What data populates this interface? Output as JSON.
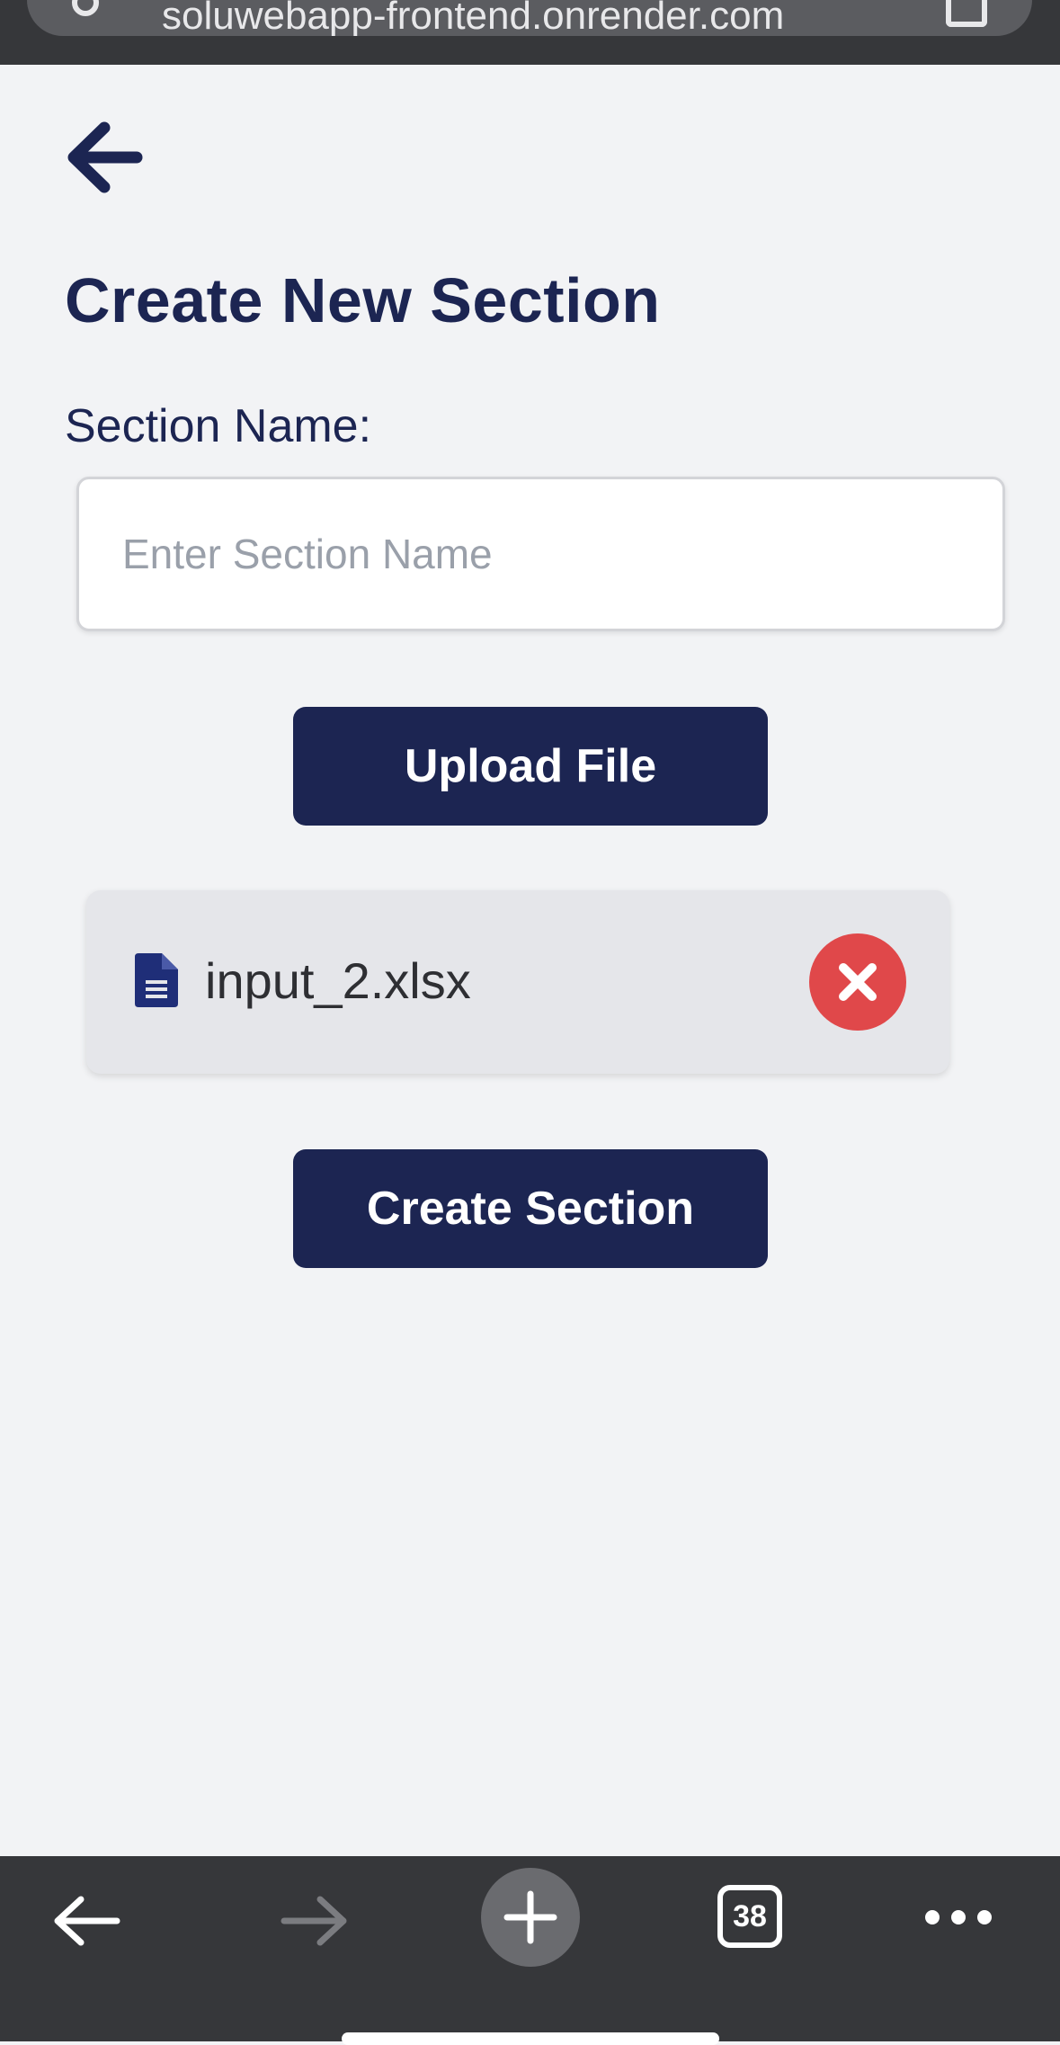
{
  "browser": {
    "url": "soluwebapp-frontend.onrender.com"
  },
  "page": {
    "title": "Create New Section",
    "section_name_label": "Section Name:",
    "section_name_placeholder": "Enter Section Name",
    "section_name_value": "",
    "upload_button_label": "Upload File",
    "create_button_label": "Create Section"
  },
  "attached_file": {
    "name": "input_2.xlsx",
    "icon": "document-icon",
    "remove_icon": "close-icon"
  },
  "bottom_nav": {
    "tabs_count": "38",
    "items": [
      "back-arrow-icon",
      "forward-arrow-icon",
      "plus-icon",
      "tabs-icon",
      "more-icon"
    ]
  },
  "colors": {
    "primary": "#1c2552",
    "danger": "#e0484a",
    "background": "#f2f3f5",
    "browser_chrome": "#36373a"
  }
}
